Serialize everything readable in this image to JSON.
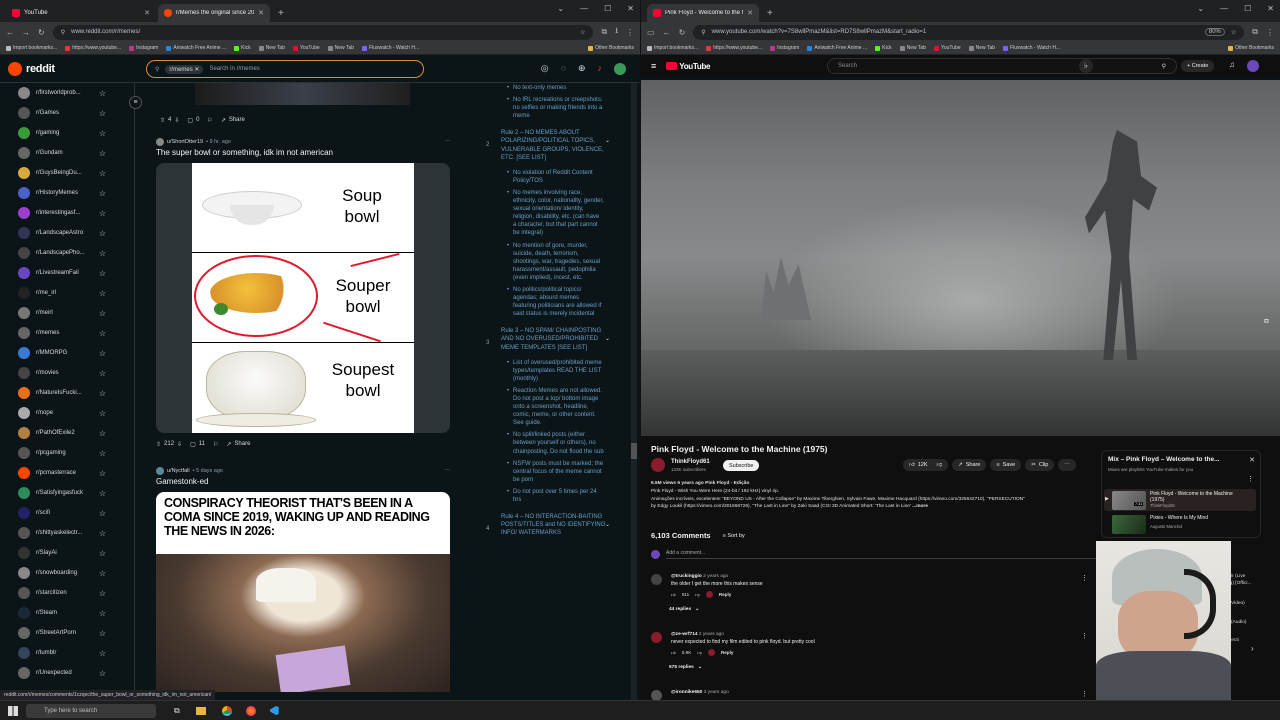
{
  "left_browser": {
    "tabs": [
      {
        "title": "YouTube",
        "favicon_color": "#ff0033"
      },
      {
        "title": "r/Memes the original since 20…",
        "favicon_color": "#ff4500"
      }
    ],
    "url": "www.reddit.com/r/memes/",
    "bookmarks": [
      "Import bookmarks...",
      "https://www.youtube...",
      "Instagram",
      "Aniwatch Free Anime ...",
      "Kick",
      "New Tab",
      "YouTube",
      "New Tab",
      "Fluxwatch - Watch H...",
      "Other Bookmarks"
    ],
    "status_url": "reddit.com/r/memes/comments/1czqec/the_super_bowl_or_something_idk_im_not_american/"
  },
  "reddit": {
    "logo": "reddit",
    "search_chip": "r/memes",
    "search_placeholder": "Search in r/memes",
    "sidebar": [
      {
        "name": "r/firstworldprob...",
        "color": "#888888"
      },
      {
        "name": "r/Games",
        "color": "#555555"
      },
      {
        "name": "r/gaming",
        "color": "#3b9b3b"
      },
      {
        "name": "r/Gundam",
        "color": "#666666"
      },
      {
        "name": "r/GuysBeingDu...",
        "color": "#d6a93d"
      },
      {
        "name": "r/HistoryMemes",
        "color": "#4a62c9"
      },
      {
        "name": "r/interestingasf...",
        "color": "#9b3fd1"
      },
      {
        "name": "r/LandscapeAstro",
        "color": "#333355"
      },
      {
        "name": "r/LandscapePho...",
        "color": "#444444"
      },
      {
        "name": "r/LivestreamFail",
        "color": "#6a46c2"
      },
      {
        "name": "r/me_irl",
        "color": "#222222"
      },
      {
        "name": "r/meirl",
        "color": "#777777"
      },
      {
        "name": "r/memes",
        "color": "#666666"
      },
      {
        "name": "r/MMORPG",
        "color": "#3a7bd5"
      },
      {
        "name": "r/movies",
        "color": "#444444"
      },
      {
        "name": "r/NatureIsFucki...",
        "color": "#e86f1d"
      },
      {
        "name": "r/nope",
        "color": "#aaaaaa"
      },
      {
        "name": "r/PathOfExile2",
        "color": "#b08045"
      },
      {
        "name": "r/pcgaming",
        "color": "#555555"
      },
      {
        "name": "r/pcmasterrace",
        "color": "#ff4500"
      },
      {
        "name": "r/Satisfyingasfuck",
        "color": "#2e8b57"
      },
      {
        "name": "r/scifi",
        "color": "#222266"
      },
      {
        "name": "r/shittyaskelectr...",
        "color": "#555555"
      },
      {
        "name": "r/SlayAi",
        "color": "#333333"
      },
      {
        "name": "r/snowboarding",
        "color": "#888888"
      },
      {
        "name": "r/starcitizen",
        "color": "#555555"
      },
      {
        "name": "r/Steam",
        "color": "#1b2838"
      },
      {
        "name": "r/StreetArtPorn",
        "color": "#666666"
      },
      {
        "name": "r/tumblr",
        "color": "#35465c"
      },
      {
        "name": "r/Unexpected",
        "color": "#666666"
      }
    ],
    "post0": {
      "upvotes": "4",
      "comments": "0",
      "share": "Share"
    },
    "post1": {
      "author": "u/ShortOtter19",
      "time": "• 9 hr. ago",
      "title": "The super bowl or something, idk im not american",
      "meme_rows": [
        {
          "line1": "Soup",
          "line2": "bowl"
        },
        {
          "line1": "Souper",
          "line2": "bowl"
        },
        {
          "line1": "Soupest",
          "line2": "bowl"
        }
      ],
      "upvotes": "212",
      "comments": "11",
      "share": "Share"
    },
    "post2": {
      "author": "u/Nyctfall",
      "time": "• 5 days ago",
      "title": "Gamestonk-ed",
      "meme_text": "CONSPIRACY THEORIST THAT'S BEEN IN A COMA SINCE 2019, WAKING UP AND READING THE NEWS IN 2026:"
    },
    "rules": [
      {
        "type": "item",
        "text": "No text-only memes"
      },
      {
        "type": "item",
        "text": "No IRL recreations or creepshots: no selfies or making friends into a meme"
      },
      {
        "type": "heading",
        "num": "2",
        "text": "Rule 2 – NO MEMES ABOUT POLARIZING/POLITICAL TOPICS, VULNERABLE GROUPS, VIOLENCE, ETC. [SEE LIST]"
      },
      {
        "type": "item",
        "text": "No violation of Reddit Content Policy/TOS"
      },
      {
        "type": "item",
        "text": "No memes involving race, ethnicity, color, nationality, gender, sexual orientation/ identity, religion, disability, etc. (can have a character, but that part cannot be integral)"
      },
      {
        "type": "item",
        "text": "No mention of gore, murder, suicide, death, terrorism, shootings, war, tragedies, sexual harassment/assault, pedophilia (even implied), incest, etc."
      },
      {
        "type": "item",
        "text": "No politics/political topics/ agendas; absurd memes featuring politicians are allowed if said status is merely incidental"
      },
      {
        "type": "heading",
        "num": "3",
        "text": "Rule 3 – NO SPAM/ CHAINPOSTING AND NO OVERUSED/PROHIBITED MEME TEMPLATES [SEE LIST]"
      },
      {
        "type": "item",
        "text": "List of overused/prohibited meme types/templates READ THE LIST (monthly)"
      },
      {
        "type": "item",
        "text": "Reaction Memes are not allowed. Do not post a top/ bottom image onto a screenshot, headline, comic, meme, or other content. See guide."
      },
      {
        "type": "item",
        "text": "No split/linked posts (either between yourself or others), no chainposting. Do not flood the sub"
      },
      {
        "type": "item",
        "text": "NSFW posts must be marked; the central focus of the meme cannot be porn"
      },
      {
        "type": "item",
        "text": "Do not post over 5 times per 24 hrs"
      },
      {
        "type": "heading",
        "num": "4",
        "text": "Rule 4 – NO INTERACTION-BAITING POSTS/TITLES and NO IDENTIFYING INFO/ WATERMARKS"
      }
    ]
  },
  "right_browser": {
    "tabs": [
      {
        "title": "Pink Floyd - Welcome to the M",
        "favicon_color": "#ff0033"
      }
    ],
    "url": "www.youtube.com/watch?v=7S8wllPmazM&list=RD7S8wllPmazM&start_radio=1",
    "zoom": "80%",
    "bookmarks": [
      "Import bookmarks...",
      "https://www.youtube...",
      "Instagram",
      "Aniwatch Free Anime ...",
      "Kick",
      "New Tab",
      "YouTube",
      "New Tab",
      "Fluxwatch - Watch H...",
      "Other Bookmarks"
    ]
  },
  "youtube": {
    "logo": "YouTube",
    "search_placeholder": "Search",
    "create": "+ Create",
    "video_title": "Pink Floyd - Welcome to the Machine (1975)",
    "channel": "ThinkFloyd61",
    "subs": "133K subscribers",
    "subscribe": "Subscribe",
    "likes": "12K",
    "share": "Share",
    "save": "Save",
    "clip": "Clip",
    "desc_meta": "6.5M views  6 years ago  Pink Floyd - Edição",
    "desc_line1": "Pink Floyd - Wish You Were Here (24-bit / 192 kHz) vinyl rip.",
    "desc_line2": "Animações incríveis, excelentes!  \"BEYOND US - After the Collapse\" by Maxime Tiberghien, Sylvain Fawe, Maxime Hacquard (https://vimeo.com/325642710), \"PERSECUTION\"",
    "desc_line3": "by Edgy Loukil (https://vimeo.com/301668729), \"The Last in Line\" by Zaki Saad (CGI 3D Animated Short: 'The Last in Line'",
    "more": "...more",
    "comments_count": "6,103 Comments",
    "sort": "Sort by",
    "add_comment": "Add a comment...",
    "comments": [
      {
        "user": "@truckinggio",
        "time": "2 years ago",
        "text": "the older I get the more this makes sense",
        "likes": "911",
        "reply": "Reply",
        "replies": "44 replies",
        "avatar": "#444444"
      },
      {
        "user": "@ze-wrf714",
        "time": "2 years ago",
        "text": "never expected to find my film edited to pink floyd. but pretty cool",
        "likes": "5.9K",
        "reply": "Reply",
        "replies": "575 replies",
        "avatar": "#8a1c2b"
      },
      {
        "user": "@ironnike650",
        "time": "3 years ago",
        "text": "",
        "likes": "",
        "reply": "",
        "replies": "",
        "avatar": "#555555"
      }
    ],
    "mix_title": "Mix – Pink Floyd – Welcome to the...",
    "mix_sub": "Mixes are playlists YouTube makes for you",
    "playlist": [
      {
        "title": "Pink Floyd - Welcome to the Machine (1975)",
        "channel": "ThinkFloyd61",
        "duration": "7:31"
      },
      {
        "title": "Pixies - Where Is My Mind",
        "channel": "Augusto Manchol",
        "duration": ""
      }
    ],
    "partial_items": [
      "mir (Live",
      "ng) [Offici...",
      "d Video)",
      "2 (Audio)",
      "Electi"
    ]
  },
  "taskbar": {
    "search_placeholder": "Type here to search"
  }
}
